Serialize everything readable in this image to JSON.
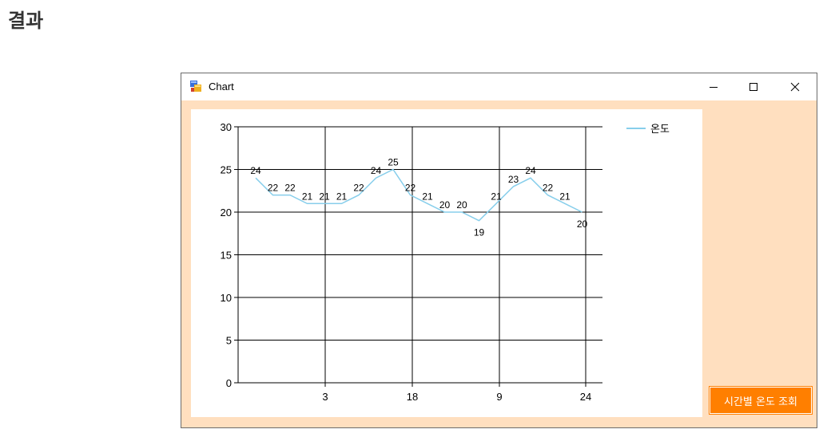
{
  "page": {
    "heading": "결과"
  },
  "window": {
    "title": "Chart",
    "icon": "winforms-app-icon",
    "controls": [
      "minimize-icon",
      "maximize-icon",
      "close-icon"
    ]
  },
  "button": {
    "label": "시간별 온도 조회"
  },
  "colors": {
    "client_bg": "#ffdfbf",
    "button_bg": "#ff7f00",
    "series": "#87ceeb"
  },
  "chart_data": {
    "type": "line",
    "legend_position": "top-right",
    "grid": true,
    "ylim": [
      0,
      30
    ],
    "y_ticks": [
      "0",
      "5",
      "10",
      "15",
      "20",
      "25",
      "30"
    ],
    "x_tick_labels": [
      "3",
      "18",
      "9",
      "24"
    ],
    "series": [
      {
        "name": "온도",
        "values": [
          24,
          22,
          22,
          21,
          21,
          21,
          22,
          24,
          25,
          22,
          21,
          20,
          20,
          19,
          21,
          23,
          24,
          22,
          21,
          20
        ]
      }
    ]
  }
}
